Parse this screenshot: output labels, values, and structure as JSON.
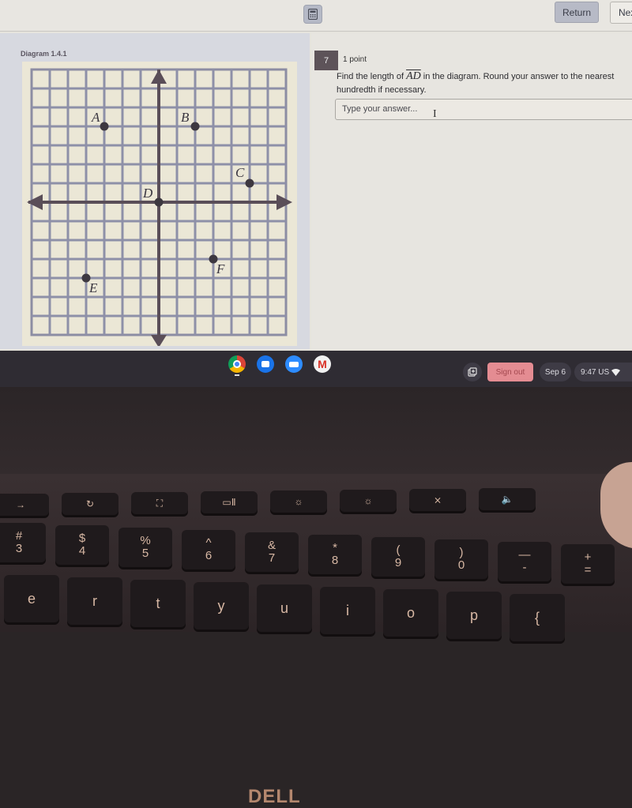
{
  "topbar": {
    "calculator_icon": "calculator-icon",
    "return_label": "Return",
    "next_label": "Nex"
  },
  "diagram": {
    "label": "Diagram 1.4.1",
    "grid": {
      "columns": 14,
      "rows": 14,
      "x_range": [
        -7,
        7
      ],
      "y_range": [
        -7,
        7
      ]
    },
    "points": [
      {
        "name": "A",
        "x": -3,
        "y": 4
      },
      {
        "name": "B",
        "x": 2,
        "y": 4
      },
      {
        "name": "C",
        "x": 5,
        "y": 1
      },
      {
        "name": "D",
        "x": 0,
        "y": 0
      },
      {
        "name": "E",
        "x": -4,
        "y": -4
      },
      {
        "name": "F",
        "x": 3,
        "y": -3
      }
    ]
  },
  "question": {
    "number": "7",
    "points": "1 point",
    "text_before": "Find the length of ",
    "segment": "AD",
    "text_after": " in the diagram.  Round your answer to the nearest hundredth if necessary.",
    "answer_value": "",
    "answer_placeholder": "Type your answer..."
  },
  "shelf": {
    "apps": [
      {
        "name": "Chrome",
        "icon": "chrome-icon"
      },
      {
        "name": "Camera",
        "icon": "camera-icon"
      },
      {
        "name": "Zoom",
        "icon": "video-icon"
      },
      {
        "name": "Gmail",
        "icon": "gmail-icon"
      }
    ],
    "gmail_glyph": "M",
    "screen_capture_icon": "screen-capture-icon",
    "sign_out": "Sign out",
    "date": "Sep 6",
    "time": "9:47",
    "locale": "US",
    "wifi_icon": "wifi-icon"
  },
  "brand": "DELL",
  "keyboard": {
    "function_row": [
      "→",
      "↻",
      "⛶",
      "▭Ⅱ",
      "☼",
      "☼",
      "⨯",
      "🔈"
    ],
    "number_row": [
      {
        "top": "#",
        "bottom": "3"
      },
      {
        "top": "$",
        "bottom": "4"
      },
      {
        "top": "%",
        "bottom": "5"
      },
      {
        "top": "^",
        "bottom": "6"
      },
      {
        "top": "&",
        "bottom": "7"
      },
      {
        "top": "*",
        "bottom": "8"
      },
      {
        "top": "(",
        "bottom": "9"
      },
      {
        "top": ")",
        "bottom": "0"
      },
      {
        "top": "—",
        "bottom": "-"
      },
      {
        "top": "+",
        "bottom": "="
      }
    ],
    "letter_row": [
      "e",
      "r",
      "t",
      "y",
      "u",
      "i",
      "o",
      "p",
      "{"
    ]
  }
}
